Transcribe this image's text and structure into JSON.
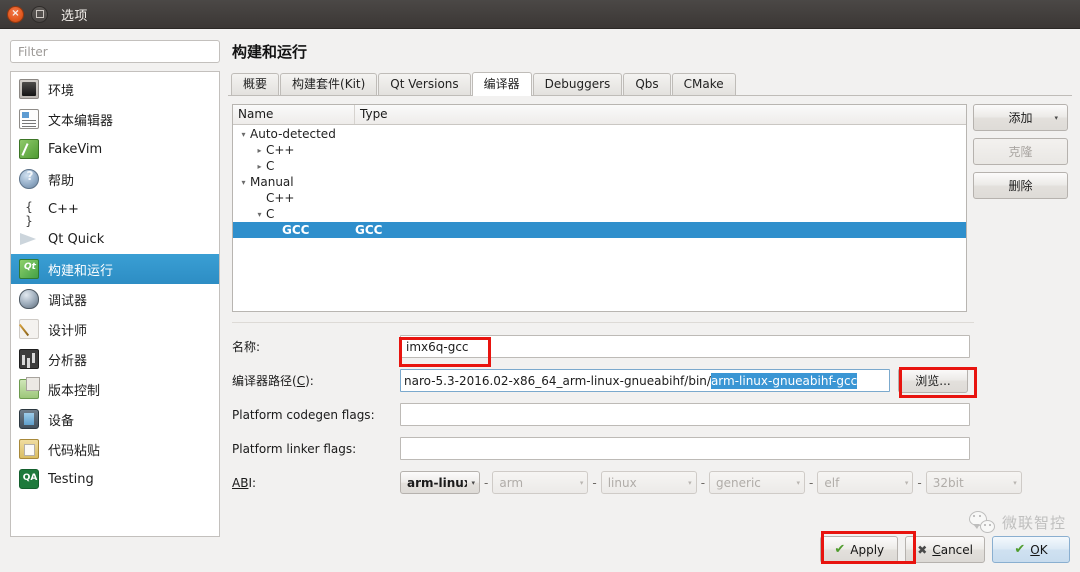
{
  "titlebar": {
    "title": "选项",
    "close_icon": "close-icon",
    "minimize_icon": "minimize-icon"
  },
  "sidebar": {
    "filter_placeholder": "Filter",
    "filter_value": "",
    "items": [
      {
        "label": "环境",
        "icon": "monitor-icon",
        "icon_class": "ic-env",
        "selected": false
      },
      {
        "label": "文本编辑器",
        "icon": "text-editor-icon",
        "icon_class": "ic-editor",
        "selected": false
      },
      {
        "label": "FakeVim",
        "icon": "fakevim-icon",
        "icon_class": "ic-fakevim",
        "selected": false
      },
      {
        "label": "帮助",
        "icon": "help-icon",
        "icon_class": "ic-help",
        "selected": false
      },
      {
        "label": "C++",
        "icon": "braces-icon",
        "icon_class": "ic-cpp",
        "selected": false
      },
      {
        "label": "Qt Quick",
        "icon": "qt-quick-icon",
        "icon_class": "ic-qtquick",
        "selected": false
      },
      {
        "label": "构建和运行",
        "icon": "build-run-icon",
        "icon_class": "ic-buildrun",
        "selected": true
      },
      {
        "label": "调试器",
        "icon": "debugger-bug-icon",
        "icon_class": "ic-debugger",
        "selected": false
      },
      {
        "label": "设计师",
        "icon": "designer-brush-icon",
        "icon_class": "ic-designer",
        "selected": false
      },
      {
        "label": "分析器",
        "icon": "analyzer-icon",
        "icon_class": "ic-analyzer",
        "selected": false
      },
      {
        "label": "版本控制",
        "icon": "version-control-icon",
        "icon_class": "ic-vcs",
        "selected": false
      },
      {
        "label": "设备",
        "icon": "device-icon",
        "icon_class": "ic-device",
        "selected": false
      },
      {
        "label": "代码粘贴",
        "icon": "code-paster-icon",
        "icon_class": "ic-paster",
        "selected": false
      },
      {
        "label": "Testing",
        "icon": "qa-testing-icon",
        "icon_class": "ic-testing",
        "selected": false
      }
    ]
  },
  "page": {
    "title": "构建和运行",
    "tabs": [
      {
        "label": "概要",
        "active": false
      },
      {
        "label": "构建套件(Kit)",
        "active": false
      },
      {
        "label": "Qt Versions",
        "active": false
      },
      {
        "label": "编译器",
        "active": true
      },
      {
        "label": "Debuggers",
        "active": false
      },
      {
        "label": "Qbs",
        "active": false
      },
      {
        "label": "CMake",
        "active": false
      }
    ]
  },
  "compiler_tree": {
    "columns": [
      "Name",
      "Type"
    ],
    "rows": [
      {
        "name": "Auto-detected",
        "type": "",
        "indent": 0,
        "arrow": "expanded",
        "selected": false
      },
      {
        "name": "C++",
        "type": "",
        "indent": 1,
        "arrow": "collapsed",
        "selected": false
      },
      {
        "name": "C",
        "type": "",
        "indent": 1,
        "arrow": "collapsed",
        "selected": false
      },
      {
        "name": "Manual",
        "type": "",
        "indent": 0,
        "arrow": "expanded",
        "selected": false
      },
      {
        "name": "C++",
        "type": "",
        "indent": 1,
        "arrow": "none",
        "selected": false
      },
      {
        "name": "C",
        "type": "",
        "indent": 1,
        "arrow": "expanded",
        "selected": false
      },
      {
        "name": "GCC",
        "type": "GCC",
        "indent": 2,
        "arrow": "none",
        "selected": true
      }
    ]
  },
  "side_buttons": [
    {
      "label": "添加",
      "name": "add-compiler-button",
      "disabled": false,
      "has_menu": true
    },
    {
      "label": "克隆",
      "name": "clone-compiler-button",
      "disabled": true,
      "has_menu": false
    },
    {
      "label": "删除",
      "name": "remove-compiler-button",
      "disabled": false,
      "has_menu": false
    }
  ],
  "form": {
    "name_label": "名称:",
    "name_value": "imx6q-gcc",
    "path_label_prefix": "编译器路径(",
    "path_label_accel": "C",
    "path_label_suffix": "):",
    "path_value_plain": "naro-5.3-2016.02-x86_64_arm-linux-gnueabihf/bin/",
    "path_value_selected": "arm-linux-gnueabihf-gcc",
    "browse_label": "浏览...",
    "codegen_label": "Platform codegen flags:",
    "codegen_value": "",
    "linker_label": "Platform linker flags:",
    "linker_value": "",
    "abi_label_accel": "AB",
    "abi_label_rest": "I:",
    "abi": [
      {
        "value": "arm-linux",
        "disabled": false
      },
      {
        "value": "arm",
        "disabled": true
      },
      {
        "value": "linux",
        "disabled": true
      },
      {
        "value": "generic",
        "disabled": true
      },
      {
        "value": "elf",
        "disabled": true
      },
      {
        "value": "32bit",
        "disabled": true
      }
    ],
    "abi_separator": "-"
  },
  "dialog_buttons": [
    {
      "label": "Apply",
      "icon": "check-icon",
      "name": "apply-button",
      "default": false,
      "accel": ""
    },
    {
      "label": "Cancel",
      "icon": "cross-icon",
      "name": "cancel-button",
      "default": false,
      "accel": "C"
    },
    {
      "label": "OK",
      "icon": "check-icon",
      "name": "ok-button",
      "default": true,
      "accel": "O"
    }
  ],
  "watermark": {
    "text": "微联智控",
    "icon": "wechat-logo-icon"
  },
  "annotations": [
    {
      "name": "name-field-highlight",
      "target": "name-input"
    },
    {
      "name": "browse-button-highlight",
      "target": "browse-button"
    },
    {
      "name": "apply-button-highlight",
      "target": "apply-button"
    }
  ],
  "colors": {
    "accent_selection": "#2f8fcc",
    "sidebar_selection": "#3a9fd4",
    "annotation_red": "#e8140f",
    "titlebar": "#3b3735"
  }
}
